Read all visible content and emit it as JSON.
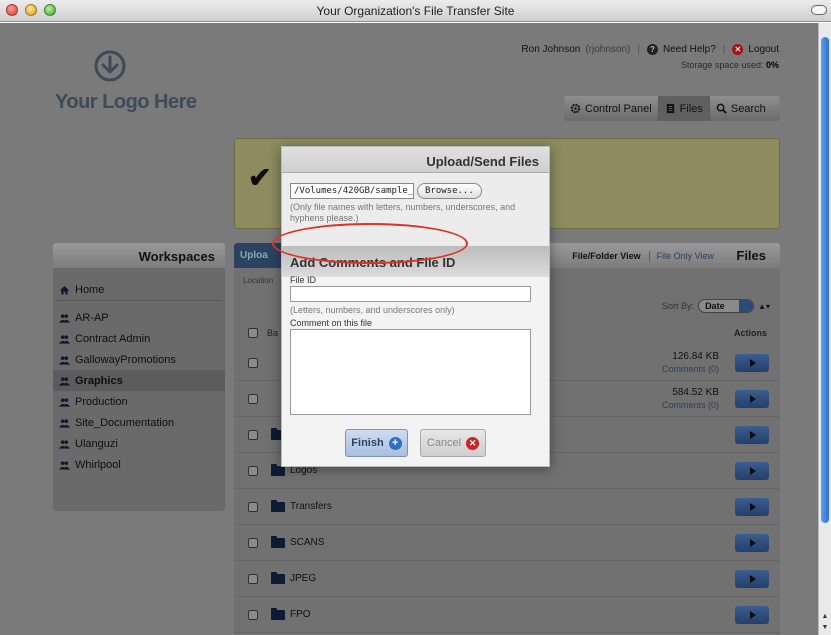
{
  "window": {
    "title": "Your Organization's File Transfer Site"
  },
  "logo": {
    "text": "Your Logo Here",
    "icon": "download-arrow-icon"
  },
  "header": {
    "user": "Ron Johnson",
    "username": "(rjohnson)",
    "help": "Need Help?",
    "logout": "Logout",
    "storage_label": "Storage space used:",
    "storage_value": "0%"
  },
  "nav": {
    "items": [
      {
        "label": "Control Panel",
        "icon": "gear-icon"
      },
      {
        "label": "Files",
        "icon": "document-icon"
      },
      {
        "label": "Search",
        "icon": "magnifier-icon"
      }
    ],
    "active": "Files"
  },
  "workspaces": {
    "title": "Workspaces",
    "home": "Home",
    "items": [
      "AR-AP",
      "Contract Admin",
      "GallowayPromotions",
      "Graphics",
      "Production",
      "Site_Documentation",
      "Ulanguzi",
      "Whirlpool"
    ],
    "active": "Graphics"
  },
  "files": {
    "title": "Files",
    "upload_tab": "Uploa",
    "location": "Location",
    "view_a": "File/Folder View",
    "view_b": "File Only View",
    "sort_label": "Sort By:",
    "sort_value": "Date",
    "col_name": "Ba",
    "col_actions": "Actions",
    "rows": [
      {
        "name": "",
        "size": "126.84 KB",
        "comments": "Comments (0)"
      },
      {
        "name": "",
        "size": "584.52 KB",
        "comments": "Comments (0)"
      },
      {
        "name": "",
        "size": "",
        "comments": ""
      },
      {
        "name": "Logos",
        "size": "",
        "comments": ""
      },
      {
        "name": "Transfers",
        "size": "",
        "comments": ""
      },
      {
        "name": "SCANS",
        "size": "",
        "comments": ""
      },
      {
        "name": "JPEG",
        "size": "",
        "comments": ""
      },
      {
        "name": "FPO",
        "size": "",
        "comments": ""
      }
    ]
  },
  "modal": {
    "title": "Upload/Send Files",
    "path": "/Volumes/420GB/sample_u",
    "browse": "Browse...",
    "hint": "(Only file names with letters, numbers, underscores, and hyphens please.)",
    "section_title": "Add Comments and File ID",
    "file_id_label": "File ID",
    "file_id_hint": "(Letters, numbers, and underscores only)",
    "comment_label": "Comment on this file",
    "finish": "Finish",
    "cancel": "Cancel"
  },
  "colors": {
    "annotation": "#e0321d",
    "accent": "#2d6fc9",
    "banner": "#8d8c5f"
  }
}
